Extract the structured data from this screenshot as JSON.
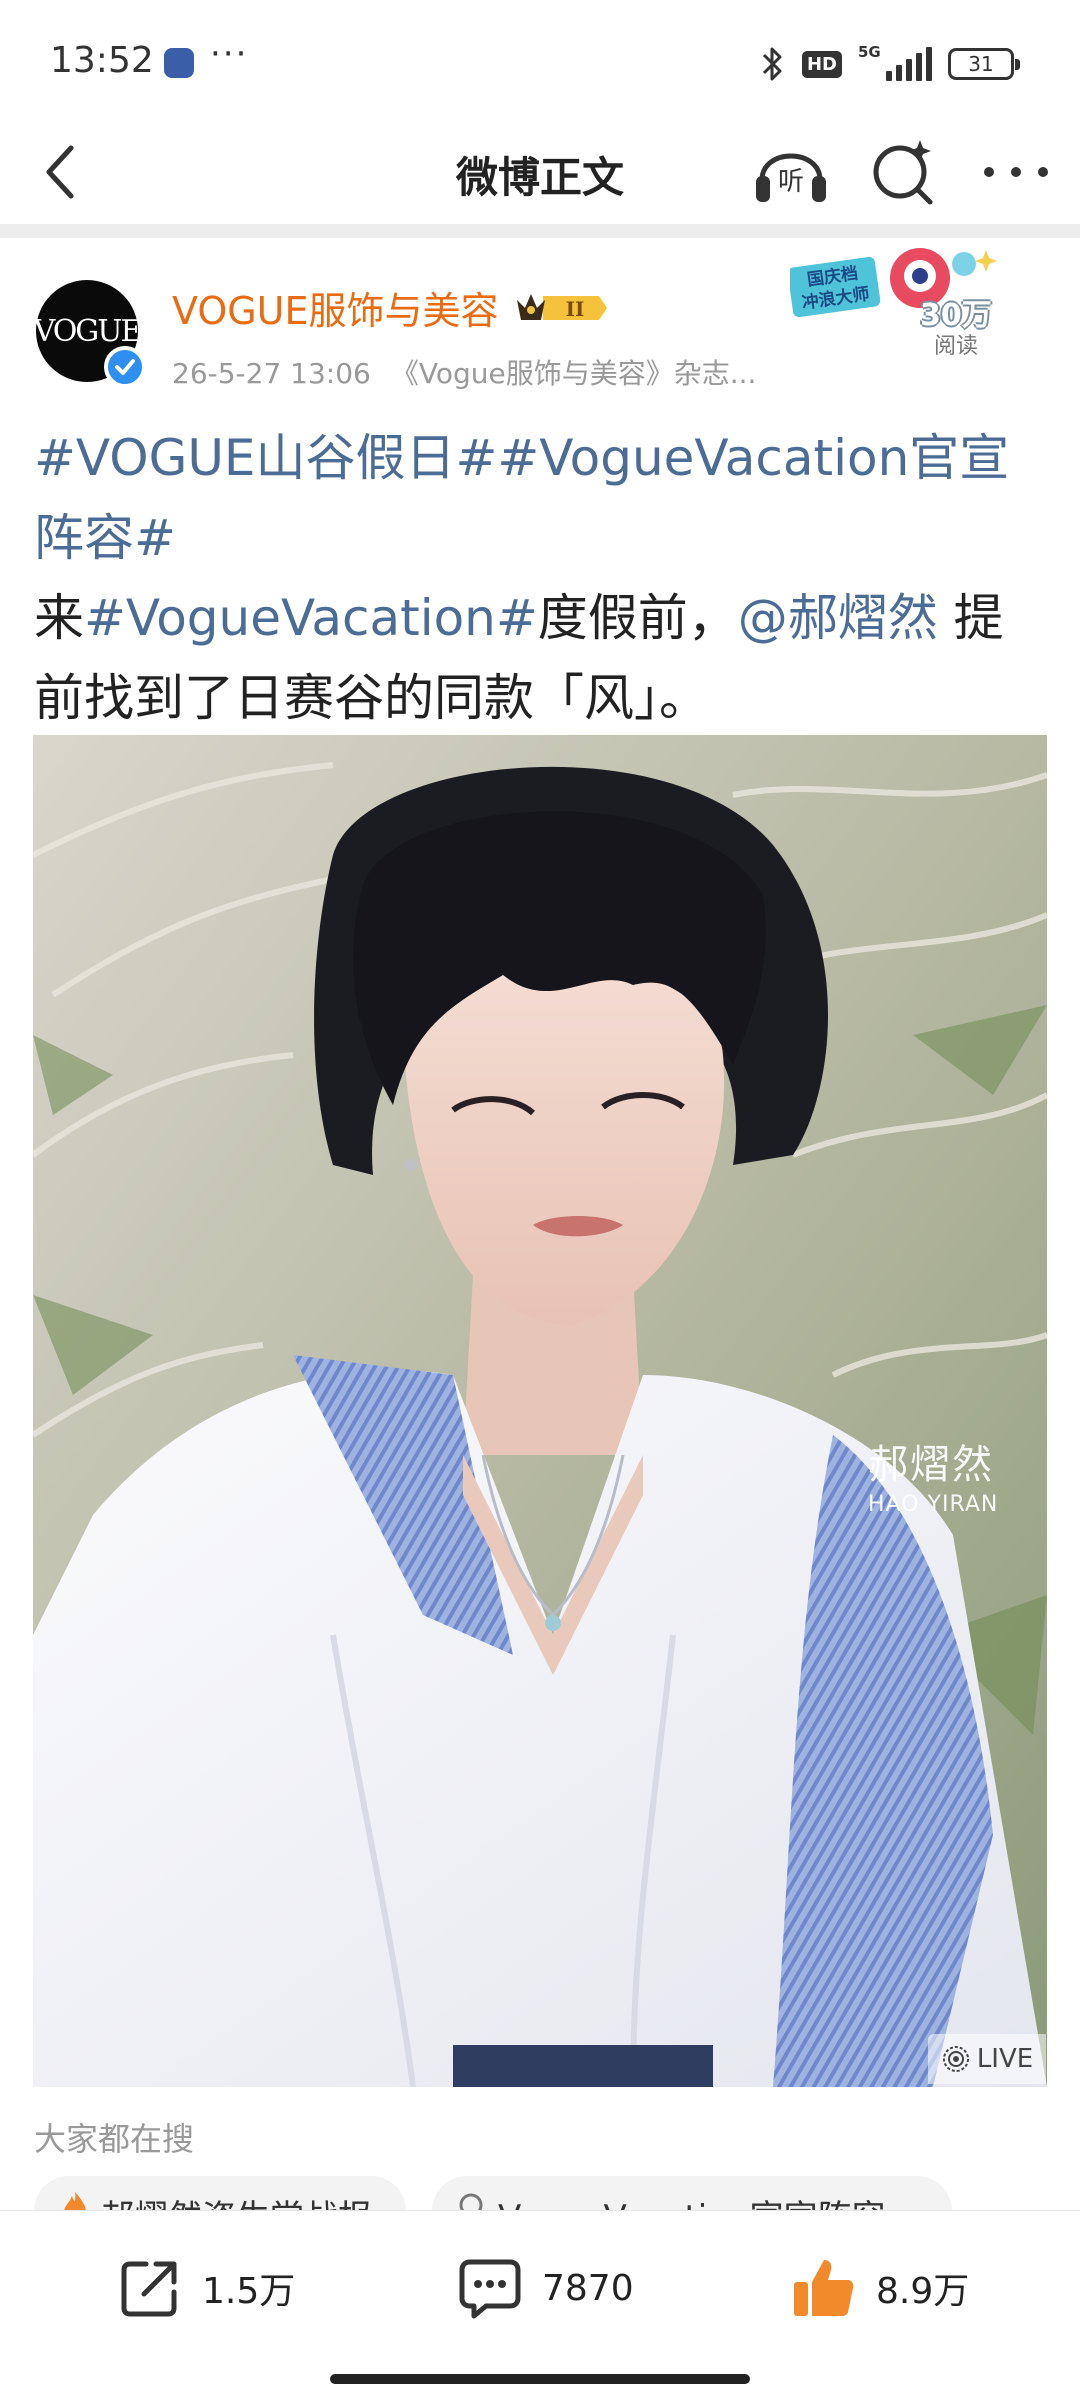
{
  "status_bar": {
    "time": "13:52",
    "more": "···",
    "hd": "HD",
    "network": "5G",
    "battery": "31"
  },
  "nav": {
    "title": "微博正文"
  },
  "post": {
    "author": "VOGUE服饰与美容",
    "avatar_text": "VOGUE",
    "time": "26-5-27 13:06",
    "source": "《Vogue服饰与美容》杂志...",
    "reads_count": "30万",
    "reads_label": "阅读",
    "reads_badge_text": "国庆档 冲浪大师",
    "body": {
      "topic1": "#VOGUE山谷假日#",
      "topic2": "#VogueVacation官宣阵容#",
      "text1": "来",
      "topic3": "#VogueVacation#",
      "text2": "度假前，",
      "mention": "@郝熠然",
      "text3": " 提前找到了日赛谷的同款「风」。"
    },
    "photo": {
      "caption_cn": "郝熠然",
      "caption_en": "HAO YIRAN",
      "live_label": "LIVE"
    }
  },
  "search_suggestions": {
    "heading": "大家都在搜",
    "items": [
      {
        "label": "郝熠然资生堂战报",
        "icon": "hot-icon"
      },
      {
        "label": "VogueVacation官宣阵容",
        "icon": "search-icon"
      }
    ]
  },
  "actions": {
    "share_count": "1.5万",
    "comment_count": "7870",
    "like_count": "8.9万"
  },
  "colors": {
    "link": "#4b6c95",
    "author": "#e96b12",
    "like": "#f28a2c",
    "verify": "#2e8ff0"
  }
}
